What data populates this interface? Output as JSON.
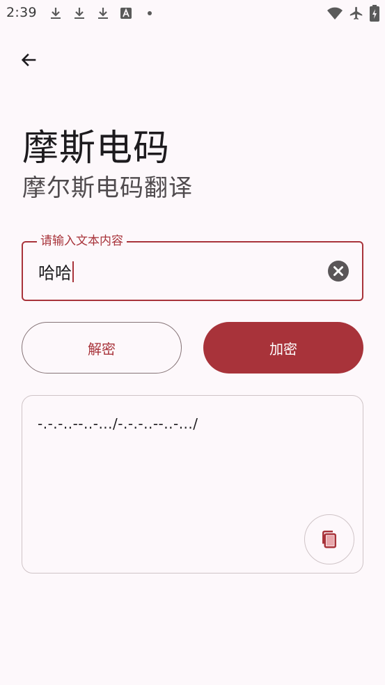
{
  "status_bar": {
    "time": "2:39",
    "left_icons": [
      "download-icon",
      "download-icon",
      "download-icon",
      "font-icon",
      "dot-icon"
    ],
    "right_icons": [
      "wifi-icon",
      "airplane-icon",
      "battery-charging-icon"
    ]
  },
  "header": {
    "back_icon": "arrow-left-icon",
    "title": "摩斯电码",
    "subtitle": "摩尔斯电码翻译"
  },
  "input": {
    "label": "请输入文本内容",
    "value": "哈哈",
    "clear_icon": "clear-icon"
  },
  "actions": {
    "decrypt_label": "解密",
    "encrypt_label": "加密"
  },
  "result": {
    "text": "-.-.-..--..-.../-.-.-..--..-.../",
    "copy_icon": "copy-icon"
  },
  "colors": {
    "primary": "#a8333a",
    "background": "#fdf8fb",
    "outline": "#857376",
    "card_outline": "#cfc4c7",
    "text": "#1d1b1e"
  }
}
